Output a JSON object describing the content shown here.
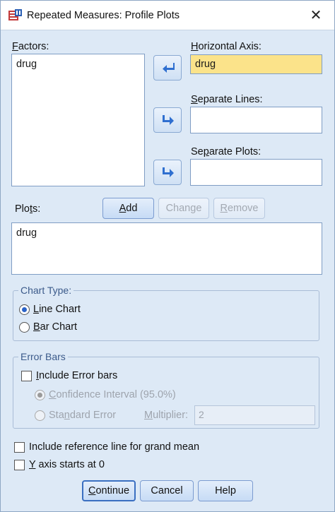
{
  "window": {
    "title": "Repeated Measures: Profile Plots",
    "close_glyph": "✕"
  },
  "factors": {
    "label_pre": "",
    "label_ul": "F",
    "label_post": "actors:",
    "items": [
      "drug"
    ]
  },
  "horizontal_axis": {
    "label_ul": "H",
    "label_post": "orizontal Axis:",
    "value": "drug"
  },
  "separate_lines": {
    "label_pre": "",
    "label_ul": "S",
    "label_post": "eparate Lines:",
    "value": ""
  },
  "separate_plots": {
    "label_pre": "Se",
    "label_ul": "p",
    "label_post": "arate Plots:",
    "value": ""
  },
  "plots": {
    "label_pre": "Plo",
    "label_ul": "t",
    "label_post": "s:",
    "items": [
      "drug"
    ],
    "add": {
      "pre": "",
      "ul": "A",
      "post": "dd"
    },
    "change": {
      "pre": "Chan",
      "ul": "g",
      "post": "e"
    },
    "remove": {
      "pre": "",
      "ul": "R",
      "post": "emove"
    }
  },
  "chart_type": {
    "legend": "Chart Type:",
    "line": {
      "ul": "L",
      "post": "ine Chart",
      "checked": true
    },
    "bar": {
      "ul": "B",
      "post": "ar Chart",
      "checked": false
    }
  },
  "error_bars": {
    "legend": "Error Bars",
    "include": {
      "pre": "",
      "ul": "I",
      "post": "nclude Error bars",
      "checked": false
    },
    "ci": {
      "pre": "",
      "ul": "C",
      "post": "onfidence Interval (95.0%)"
    },
    "se": {
      "pre": "Sta",
      "ul": "n",
      "post": "dard Error"
    },
    "multiplier": {
      "pre": "",
      "ul": "M",
      "post": "ultiplier:",
      "value": "2"
    }
  },
  "options": {
    "grand_mean": {
      "pre": "Include reference line for ",
      "ul": "g",
      "post": "rand mean",
      "checked": false
    },
    "y_axis": {
      "pre": "",
      "ul": "Y",
      "post": " axis starts at 0",
      "checked": false
    }
  },
  "footer": {
    "continue": {
      "ul": "C",
      "post": "ontinue"
    },
    "cancel": "Cancel",
    "help": "Help"
  }
}
